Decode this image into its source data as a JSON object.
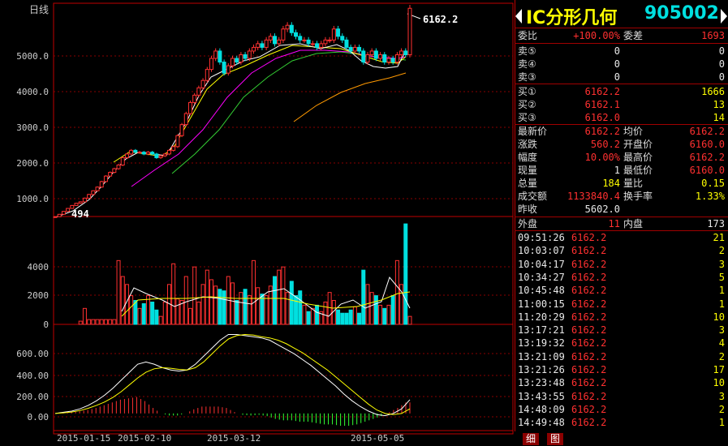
{
  "chart": {
    "period_label": "日线",
    "last_price_label": "6162.2",
    "min_price_label": "494",
    "price_axis": [
      "5000.0",
      "4000.0",
      "3000.0",
      "2000.0",
      "1000.0"
    ],
    "volume_axis": [
      "4000",
      "2000",
      "0"
    ],
    "macd_axis": [
      "600.00",
      "400.00",
      "200.00",
      "0.00"
    ],
    "dates": [
      "2015-01-15",
      "2015-02-10",
      "2015-03-12",
      "2015-05-05"
    ]
  },
  "chart_data": {
    "type": "candlestick",
    "price_ylim": [
      500,
      6300
    ],
    "volume_ylim": [
      0,
      6000
    ],
    "macd_ylim": [
      -150,
      750
    ],
    "closes": [
      494,
      560,
      640,
      720,
      800,
      860,
      900,
      1000,
      1100,
      1200,
      1300,
      1450,
      1600,
      1700,
      1800,
      1900,
      2100,
      2200,
      2300,
      2250,
      2250,
      2200,
      2250,
      2200,
      2100,
      2150,
      2200,
      2300,
      2400,
      2700,
      3000,
      3300,
      3600,
      3800,
      4000,
      4200,
      4500,
      4800,
      5000,
      4700,
      4400,
      4600,
      4800,
      4700,
      4900,
      4800,
      5000,
      5100,
      5200,
      5100,
      5300,
      5400,
      5200,
      5300,
      5600,
      5700,
      5500,
      5400,
      5300,
      5300,
      5200,
      5200,
      5100,
      5200,
      5300,
      5300,
      5600,
      5400,
      5300,
      5100,
      5000,
      5100,
      5000,
      4700,
      4900,
      5000,
      4800,
      4900,
      4700,
      4800,
      4700,
      4900,
      5000,
      4900,
      6162.2
    ],
    "volume": [
      0,
      0,
      0,
      0,
      0,
      0,
      200,
      1000,
      300,
      300,
      300,
      300,
      300,
      300,
      300,
      4000,
      3000,
      2500,
      1800,
      1500,
      1000,
      1300,
      1800,
      1400,
      900,
      500,
      1400,
      2500,
      3800,
      1600,
      1500,
      3000,
      1000,
      3600,
      1400,
      2500,
      3400,
      2800,
      2400,
      2200,
      2100,
      3000,
      2600,
      1500,
      2000,
      2200,
      1800,
      4000,
      2300,
      1900,
      1800,
      2400,
      3000,
      3400,
      3600,
      2000,
      2700,
      1800,
      2100,
      1200,
      800,
      1000,
      1200,
      800,
      1400,
      2000,
      1500,
      900,
      700,
      700,
      900,
      1100,
      700,
      3400,
      2500,
      2000,
      1800,
      1200,
      1000,
      1200,
      1800,
      4000,
      2500,
      6300,
      500
    ],
    "macd_dif": [
      0,
      10,
      20,
      40,
      70,
      110,
      160,
      220,
      290,
      360,
      430,
      450,
      430,
      400,
      380,
      370,
      380,
      430,
      500,
      570,
      640,
      690,
      690,
      680,
      670,
      660,
      640,
      600,
      560,
      520,
      470,
      420,
      360,
      300,
      240,
      170,
      110,
      60,
      20,
      -10,
      -20,
      0,
      40,
      120
    ],
    "macd_dea": [
      0,
      5,
      12,
      25,
      45,
      70,
      100,
      140,
      190,
      250,
      310,
      360,
      390,
      400,
      395,
      385,
      380,
      400,
      450,
      520,
      590,
      650,
      680,
      690,
      685,
      670,
      660,
      640,
      610,
      570,
      530,
      480,
      430,
      380,
      320,
      260,
      200,
      140,
      80,
      30,
      0,
      -10,
      0,
      40
    ]
  },
  "panel": {
    "name": "IC分形几何",
    "code": "905002",
    "weibi_label": "委比",
    "weibi": "+100.00%",
    "weicha_label": "委差",
    "weicha": "1693",
    "sells": [
      {
        "label": "卖⑤",
        "price": "0",
        "vol": "0"
      },
      {
        "label": "卖④",
        "price": "0",
        "vol": "0"
      },
      {
        "label": "卖③",
        "price": "0",
        "vol": "0"
      }
    ],
    "buys": [
      {
        "label": "买①",
        "price": "6162.2",
        "vol": "1666"
      },
      {
        "label": "买②",
        "price": "6162.1",
        "vol": "13"
      },
      {
        "label": "买③",
        "price": "6162.0",
        "vol": "14"
      }
    ],
    "stats": [
      {
        "l1": "最新价",
        "v1": "6162.2",
        "l2": "均价",
        "v2": "6162.2"
      },
      {
        "l1": "涨跌",
        "v1": "560.2",
        "l2": "开盘价",
        "v2": "6160.0"
      },
      {
        "l1": "幅度",
        "v1": "10.00%",
        "l2": "最高价",
        "v2": "6162.2"
      },
      {
        "l1": "现量",
        "v1": "1",
        "l2": "最低价",
        "v2": "6160.0"
      },
      {
        "l1": "总量",
        "v1": "184",
        "l2": "量比",
        "v2": "0.15"
      },
      {
        "l1": "成交额",
        "v1": "1133840.4",
        "l2": "换手率",
        "v2": "1.33%"
      }
    ],
    "prev_close_label": "昨收",
    "prev_close": "5602.0",
    "outer_label": "外盘",
    "outer": "11",
    "inner_label": "内盘",
    "inner": "173",
    "ticks": [
      {
        "t": "09:51:26",
        "p": "6162.2",
        "v": "21"
      },
      {
        "t": "10:03:07",
        "p": "6162.2",
        "v": "2"
      },
      {
        "t": "10:04:17",
        "p": "6162.2",
        "v": "3"
      },
      {
        "t": "10:34:27",
        "p": "6162.2",
        "v": "5"
      },
      {
        "t": "10:45:48",
        "p": "6162.2",
        "v": "1"
      },
      {
        "t": "11:00:15",
        "p": "6162.2",
        "v": "1"
      },
      {
        "t": "11:20:29",
        "p": "6162.2",
        "v": "10"
      },
      {
        "t": "13:17:21",
        "p": "6162.2",
        "v": "3"
      },
      {
        "t": "13:19:32",
        "p": "6162.2",
        "v": "4"
      },
      {
        "t": "13:21:09",
        "p": "6162.2",
        "v": "2"
      },
      {
        "t": "13:21:26",
        "p": "6162.2",
        "v": "17"
      },
      {
        "t": "13:23:48",
        "p": "6162.2",
        "v": "10"
      },
      {
        "t": "13:43:55",
        "p": "6162.2",
        "v": "3"
      },
      {
        "t": "14:48:09",
        "p": "6162.2",
        "v": "2"
      },
      {
        "t": "14:49:48",
        "p": "6162.2",
        "v": "1"
      }
    ],
    "tab_detail": "细",
    "tab_chart": "图"
  }
}
